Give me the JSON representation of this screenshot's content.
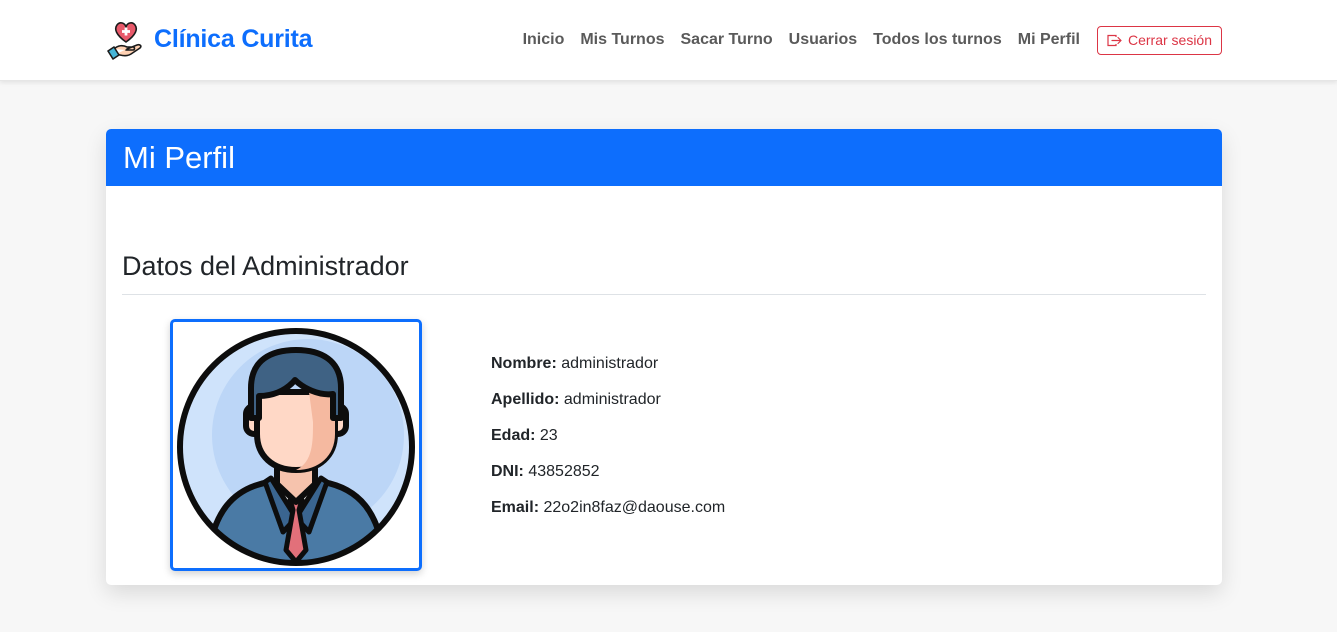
{
  "brand": {
    "name": "Clínica Curita",
    "logo_icon": "heart-hand-icon"
  },
  "nav": {
    "links": [
      "Inicio",
      "Mis Turnos",
      "Sacar Turno",
      "Usuarios",
      "Todos los turnos",
      "Mi Perfil"
    ],
    "logout_label": "Cerrar sesión",
    "logout_icon": "box-arrow-right-icon"
  },
  "card": {
    "title": "Mi Perfil",
    "section_title": "Datos del Administrador",
    "avatar_icon": "businessman-avatar-icon"
  },
  "profile": {
    "nombre_label": "Nombre:",
    "nombre": "administrador",
    "apellido_label": "Apellido:",
    "apellido": "administrador",
    "edad_label": "Edad:",
    "edad": "23",
    "dni_label": "DNI:",
    "dni": "43852852",
    "email_label": "Email:",
    "email": "22o2in8faz@daouse.com"
  },
  "colors": {
    "primary": "#0d6efd",
    "danger": "#dc3545",
    "background": "#f7f7f7"
  }
}
